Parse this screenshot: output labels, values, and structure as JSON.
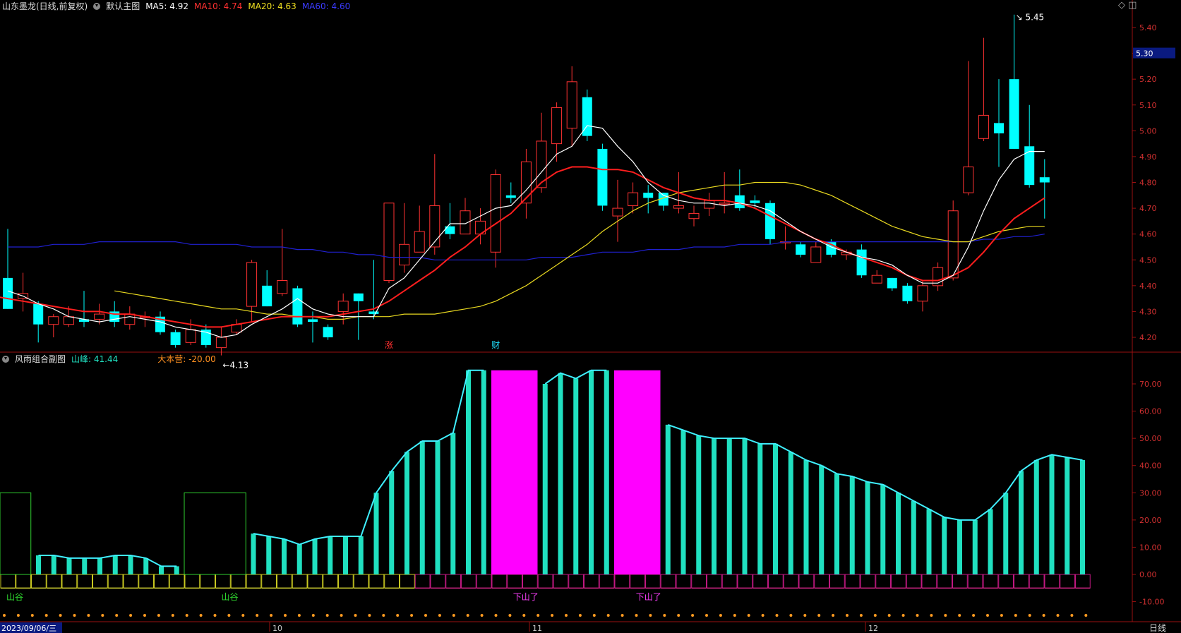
{
  "header": {
    "stock": "山东墨龙(日线,前复权)",
    "main_label": "默认主图",
    "ma": [
      {
        "label": "MA5: 4.92",
        "color": "#ffffff"
      },
      {
        "label": "MA10: 4.74",
        "color": "#ff2a2a"
      },
      {
        "label": "MA20: 4.63",
        "color": "#f0e020"
      },
      {
        "label": "MA60: 4.60",
        "color": "#2828ff"
      }
    ]
  },
  "sub_header": {
    "label": "风雨组合副图",
    "shanfeng": "山峰: 41.44",
    "dabenying": "大本营: -20.00"
  },
  "top_icons": "◇ ◫",
  "colors": {
    "up": "#ff3232",
    "down": "#00ffff",
    "bg": "#000000",
    "axis": "#9a1010",
    "magenta": "#ff00ff",
    "teal": "#20e0c0"
  },
  "chart_data": {
    "type": "candlestick",
    "price_axis": {
      "ylim": [
        4.12,
        5.47
      ],
      "ticks": [
        "4.20",
        "4.30",
        "4.40",
        "4.50",
        "4.60",
        "4.70",
        "4.80",
        "4.90",
        "5.00",
        "5.10",
        "5.20",
        "5.30",
        "5.40"
      ],
      "current": "5.30"
    },
    "annotations": {
      "high": "5.45",
      "low": "4.13",
      "markers": [
        "涨",
        "财"
      ]
    },
    "candles": [
      [
        4.43,
        4.31,
        4.62,
        4.31
      ],
      [
        4.35,
        4.37,
        4.45,
        4.3
      ],
      [
        4.33,
        4.25,
        4.34,
        4.18
      ],
      [
        4.25,
        4.28,
        4.29,
        4.2
      ],
      [
        4.25,
        4.28,
        4.32,
        4.24
      ],
      [
        4.27,
        4.26,
        4.38,
        4.24
      ],
      [
        4.27,
        4.29,
        4.33,
        4.25
      ],
      [
        4.3,
        4.26,
        4.34,
        4.24
      ],
      [
        4.25,
        4.29,
        4.32,
        4.23
      ],
      [
        4.28,
        4.28,
        4.3,
        4.24
      ],
      [
        4.28,
        4.22,
        4.3,
        4.21
      ],
      [
        4.22,
        4.17,
        4.23,
        4.16
      ],
      [
        4.18,
        4.23,
        4.27,
        4.17
      ],
      [
        4.23,
        4.17,
        4.25,
        4.16
      ],
      [
        4.16,
        4.2,
        4.24,
        4.13
      ],
      [
        4.22,
        4.25,
        4.27,
        4.21
      ],
      [
        4.32,
        4.49,
        4.5,
        4.26
      ],
      [
        4.4,
        4.32,
        4.46,
        4.32
      ],
      [
        4.37,
        4.42,
        4.62,
        4.36
      ],
      [
        4.39,
        4.25,
        4.4,
        4.24
      ],
      [
        4.27,
        4.26,
        4.3,
        4.18
      ],
      [
        4.24,
        4.2,
        4.25,
        4.19
      ],
      [
        4.3,
        4.34,
        4.37,
        4.25
      ],
      [
        4.37,
        4.34,
        4.37,
        4.19
      ],
      [
        4.3,
        4.29,
        4.5,
        4.27
      ],
      [
        4.42,
        4.72,
        4.72,
        4.41
      ],
      [
        4.48,
        4.56,
        4.72,
        4.45
      ],
      [
        4.53,
        4.61,
        4.71,
        4.53
      ],
      [
        4.55,
        4.71,
        4.91,
        4.52
      ],
      [
        4.63,
        4.6,
        4.72,
        4.58
      ],
      [
        4.6,
        4.69,
        4.74,
        4.62
      ],
      [
        4.6,
        4.65,
        4.7,
        4.56
      ],
      [
        4.53,
        4.83,
        4.85,
        4.47
      ],
      [
        4.75,
        4.74,
        4.8,
        4.72
      ],
      [
        4.72,
        4.88,
        4.93,
        4.66
      ],
      [
        4.78,
        4.96,
        5.07,
        4.76
      ],
      [
        4.95,
        5.09,
        5.11,
        4.88
      ],
      [
        5.01,
        5.19,
        5.25,
        4.94
      ],
      [
        5.13,
        4.98,
        5.16,
        4.96
      ],
      [
        4.93,
        4.71,
        4.95,
        4.69
      ],
      [
        4.67,
        4.7,
        4.81,
        4.57
      ],
      [
        4.71,
        4.76,
        4.8,
        4.68
      ],
      [
        4.76,
        4.74,
        4.79,
        4.68
      ],
      [
        4.76,
        4.71,
        4.76,
        4.69
      ],
      [
        4.7,
        4.71,
        4.84,
        4.68
      ],
      [
        4.66,
        4.68,
        4.71,
        4.63
      ],
      [
        4.7,
        4.73,
        4.76,
        4.67
      ],
      [
        4.72,
        4.72,
        4.84,
        4.68
      ],
      [
        4.75,
        4.7,
        4.85,
        4.69
      ],
      [
        4.73,
        4.72,
        4.75,
        4.7
      ],
      [
        4.72,
        4.58,
        4.73,
        4.56
      ],
      [
        4.57,
        4.57,
        4.63,
        4.54
      ],
      [
        4.56,
        4.52,
        4.57,
        4.51
      ],
      [
        4.49,
        4.55,
        4.57,
        4.49
      ],
      [
        4.57,
        4.52,
        4.58,
        4.51
      ],
      [
        4.52,
        4.53,
        4.54,
        4.5
      ],
      [
        4.54,
        4.44,
        4.56,
        4.43
      ],
      [
        4.41,
        4.44,
        4.46,
        4.41
      ],
      [
        4.43,
        4.39,
        4.43,
        4.38
      ],
      [
        4.4,
        4.34,
        4.41,
        4.33
      ],
      [
        4.34,
        4.4,
        4.42,
        4.3
      ],
      [
        4.4,
        4.47,
        4.49,
        4.38
      ],
      [
        4.43,
        4.69,
        4.73,
        4.42
      ],
      [
        4.76,
        4.86,
        5.27,
        4.75
      ],
      [
        4.97,
        5.06,
        5.36,
        4.96
      ],
      [
        5.03,
        4.99,
        5.2,
        4.86
      ],
      [
        5.2,
        4.93,
        5.45,
        4.93
      ],
      [
        4.94,
        4.79,
        5.1,
        4.78
      ],
      [
        4.82,
        4.8,
        4.89,
        4.66
      ]
    ],
    "ma5": [
      4.38,
      4.36,
      4.33,
      4.31,
      4.28,
      4.27,
      4.26,
      4.27,
      4.28,
      4.27,
      4.26,
      4.24,
      4.23,
      4.22,
      4.2,
      4.21,
      4.25,
      4.28,
      4.31,
      4.35,
      4.31,
      4.29,
      4.28,
      4.28,
      4.28,
      4.39,
      4.43,
      4.5,
      4.57,
      4.64,
      4.64,
      4.67,
      4.7,
      4.71,
      4.77,
      4.84,
      4.91,
      4.94,
      5.02,
      5.01,
      4.94,
      4.88,
      4.8,
      4.75,
      4.73,
      4.72,
      4.72,
      4.71,
      4.72,
      4.71,
      4.69,
      4.65,
      4.61,
      4.58,
      4.55,
      4.53,
      4.51,
      4.5,
      4.48,
      4.44,
      4.41,
      4.41,
      4.44,
      4.55,
      4.69,
      4.81,
      4.89,
      4.92,
      4.92
    ],
    "ma10": [
      4.36,
      4.35,
      4.34,
      4.33,
      4.32,
      4.31,
      4.3,
      4.3,
      4.29,
      4.29,
      4.28,
      4.27,
      4.26,
      4.25,
      4.24,
      4.24,
      4.25,
      4.26,
      4.27,
      4.28,
      4.28,
      4.28,
      4.28,
      4.29,
      4.3,
      4.31,
      4.34,
      4.38,
      4.42,
      4.46,
      4.51,
      4.55,
      4.6,
      4.64,
      4.68,
      4.74,
      4.8,
      4.84,
      4.86,
      4.86,
      4.85,
      4.85,
      4.84,
      4.81,
      4.78,
      4.76,
      4.74,
      4.73,
      4.73,
      4.72,
      4.7,
      4.67,
      4.64,
      4.61,
      4.58,
      4.56,
      4.53,
      4.51,
      4.49,
      4.47,
      4.44,
      4.42,
      4.42,
      4.44,
      4.47,
      4.53,
      4.6,
      4.66,
      4.7,
      4.74
    ],
    "ma20": [
      4.38,
      4.37,
      4.36,
      4.35,
      4.34,
      4.33,
      4.32,
      4.31,
      4.31,
      4.3,
      4.29,
      4.29,
      4.28,
      4.28,
      4.27,
      4.27,
      4.28,
      4.28,
      4.28,
      4.29,
      4.29,
      4.29,
      4.3,
      4.31,
      4.32,
      4.34,
      4.37,
      4.4,
      4.44,
      4.48,
      4.52,
      4.56,
      4.61,
      4.65,
      4.69,
      4.72,
      4.74,
      4.76,
      4.77,
      4.78,
      4.79,
      4.79,
      4.8,
      4.8,
      4.8,
      4.79,
      4.77,
      4.75,
      4.72,
      4.69,
      4.66,
      4.63,
      4.61,
      4.59,
      4.58,
      4.57,
      4.57,
      4.59,
      4.61,
      4.62,
      4.63,
      4.63
    ],
    "ma60": [
      4.55,
      4.55,
      4.55,
      4.56,
      4.56,
      4.56,
      4.57,
      4.57,
      4.57,
      4.57,
      4.57,
      4.57,
      4.56,
      4.56,
      4.56,
      4.56,
      4.55,
      4.55,
      4.55,
      4.54,
      4.54,
      4.53,
      4.53,
      4.52,
      4.52,
      4.51,
      4.51,
      4.51,
      4.5,
      4.5,
      4.5,
      4.5,
      4.5,
      4.5,
      4.5,
      4.51,
      4.51,
      4.51,
      4.52,
      4.53,
      4.53,
      4.53,
      4.54,
      4.54,
      4.54,
      4.55,
      4.55,
      4.55,
      4.56,
      4.56,
      4.56,
      4.57,
      4.57,
      4.57,
      4.57,
      4.57,
      4.57,
      4.57,
      4.57,
      4.57,
      4.57,
      4.57,
      4.57,
      4.57,
      4.58,
      4.58,
      4.59,
      4.59,
      4.6
    ],
    "sub": {
      "ylim": [
        -13,
        78
      ],
      "ticks": [
        "70.00",
        "60.00",
        "50.00",
        "40.00",
        "30.00",
        "20.00",
        "10.00",
        "0.00",
        "-10.00"
      ],
      "shanfeng": [
        30,
        8,
        7,
        7,
        6,
        6,
        6,
        7,
        7,
        6,
        3,
        3,
        30,
        30,
        9,
        11,
        15,
        14,
        13,
        11,
        13,
        14,
        14,
        14,
        30,
        38,
        45,
        49,
        49,
        52,
        75,
        75,
        75,
        62,
        66,
        70,
        74,
        72,
        75,
        75,
        75,
        75,
        58,
        55,
        53,
        51,
        50,
        50,
        50,
        48,
        48,
        45,
        42,
        40,
        37,
        36,
        34,
        33,
        30,
        27,
        24,
        21,
        20,
        20,
        24,
        30,
        38,
        42,
        44,
        43,
        42
      ],
      "magenta_spans": [
        [
          32,
          34
        ],
        [
          40,
          42
        ]
      ],
      "green_boxes": [
        [
          0,
          1
        ],
        [
          12,
          15
        ]
      ],
      "labels": [
        "山谷",
        "山谷",
        "下山了",
        "下山了"
      ]
    },
    "dates": {
      "first": "2023/09/06/三",
      "months": [
        "10",
        "11",
        "12"
      ],
      "period": "日线"
    }
  }
}
